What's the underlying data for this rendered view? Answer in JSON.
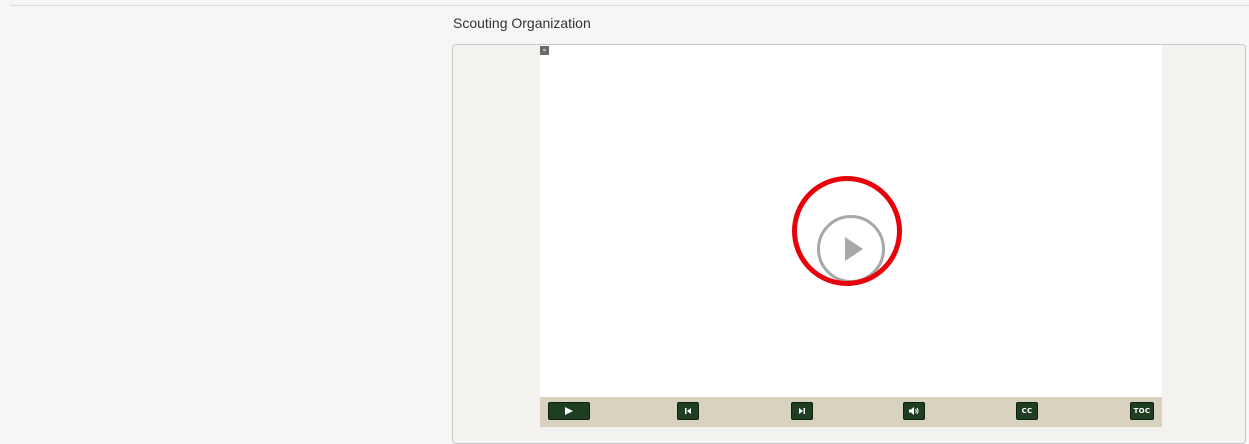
{
  "page": {
    "title": "Scouting Organization"
  },
  "player": {
    "expand_toggle_glyph": "»",
    "big_play_icon": "play-circle-icon",
    "highlight_color": "#e8000b",
    "controls": {
      "play_icon": "play-icon",
      "prev_icon": "skip-previous-icon",
      "next_icon": "skip-next-icon",
      "volume_icon": "volume-icon",
      "cc_label": "CC",
      "toc_label": "TOC"
    },
    "colors": {
      "control_button_bg": "#1e3d22",
      "control_bar_bg": "#d8d2bf",
      "stage_bg": "#ffffff"
    }
  }
}
